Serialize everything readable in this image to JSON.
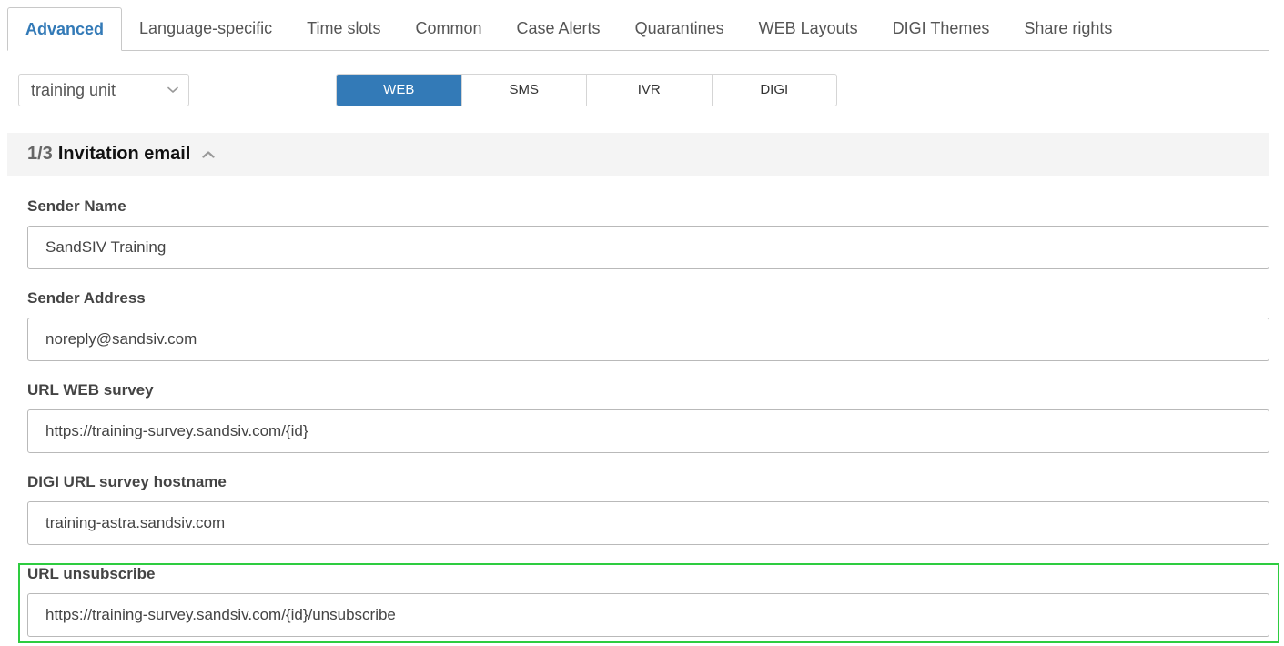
{
  "tabs": [
    {
      "label": "Advanced",
      "active": true
    },
    {
      "label": "Language-specific",
      "active": false
    },
    {
      "label": "Time slots",
      "active": false
    },
    {
      "label": "Common",
      "active": false
    },
    {
      "label": "Case Alerts",
      "active": false
    },
    {
      "label": "Quarantines",
      "active": false
    },
    {
      "label": "WEB Layouts",
      "active": false
    },
    {
      "label": "DIGI Themes",
      "active": false
    },
    {
      "label": "Share rights",
      "active": false
    }
  ],
  "unit_select": {
    "value": "training unit",
    "icon": "chevron-down-icon"
  },
  "channels": [
    {
      "label": "WEB",
      "active": true
    },
    {
      "label": "SMS",
      "active": false
    },
    {
      "label": "IVR",
      "active": false
    },
    {
      "label": "DIGI",
      "active": false
    }
  ],
  "section": {
    "counter": "1/3",
    "title": "Invitation email",
    "icon": "chevron-up-icon"
  },
  "fields": [
    {
      "label": "Sender Name",
      "value": "SandSIV Training"
    },
    {
      "label": "Sender Address",
      "value": "noreply@sandsiv.com"
    },
    {
      "label": "URL WEB survey",
      "value": "https://training-survey.sandsiv.com/{id}"
    },
    {
      "label": "DIGI URL survey hostname",
      "value": "training-astra.sandsiv.com"
    },
    {
      "label": "URL unsubscribe",
      "value": "https://training-survey.sandsiv.com/{id}/unsubscribe"
    }
  ],
  "colors": {
    "accent": "#337ab7",
    "highlight": "#2ecc40"
  }
}
